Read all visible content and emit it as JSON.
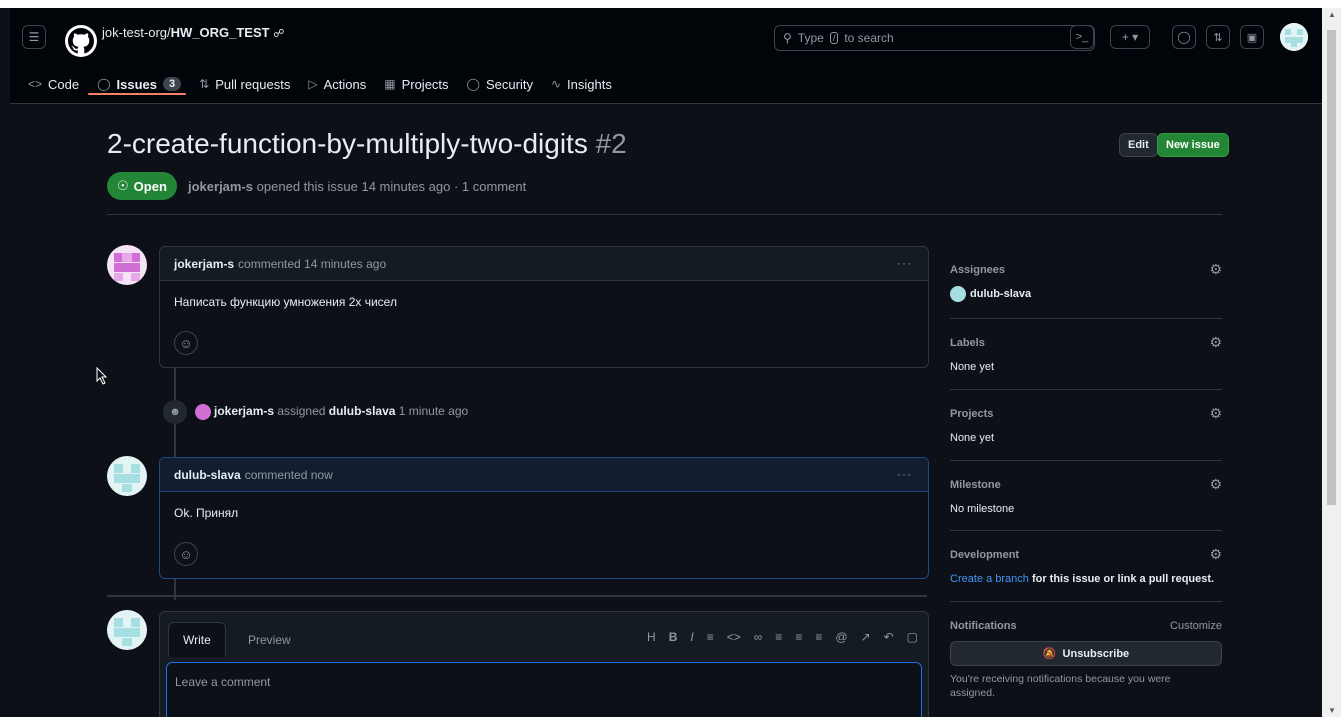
{
  "header": {
    "repo_owner": "jok-test-org/",
    "repo_name": "HW_ORG_TEST",
    "search_placeholder": "Type",
    "search_kbd": "/",
    "search_suffix": "to search"
  },
  "nav": {
    "code": "Code",
    "issues": "Issues",
    "issues_count": "3",
    "pull_requests": "Pull requests",
    "actions": "Actions",
    "projects": "Projects",
    "security": "Security",
    "insights": "Insights"
  },
  "issue": {
    "title": "2-create-function-by-multiply-two-digits",
    "number": "#2",
    "state": "Open",
    "author": "jokerjam-s",
    "meta_text": "opened this issue 14 minutes ago · 1 comment",
    "edit_label": "Edit",
    "new_issue_label": "New issue"
  },
  "comments": [
    {
      "author": "jokerjam-s",
      "time": "commented 14 minutes ago",
      "body": "Написать функцию умножения 2х чисел"
    },
    {
      "author": "dulub-slava",
      "time": "commented now",
      "body": "Ok. Принял"
    }
  ],
  "event": {
    "actor": "jokerjam-s",
    "action": "assigned",
    "target": "dulub-slava",
    "time": "1 minute ago"
  },
  "composer": {
    "write_tab": "Write",
    "preview_tab": "Preview",
    "placeholder": "Leave a comment",
    "toolbar_icons": [
      "heading-icon",
      "bold-icon",
      "italic-icon",
      "quote-icon",
      "code-icon",
      "link-icon",
      "unordered-list-icon",
      "ordered-list-icon",
      "task-list-icon",
      "mention-icon",
      "reference-icon",
      "undo-icon",
      "slash-command-icon"
    ]
  },
  "sidebar": {
    "assignees_title": "Assignees",
    "assignee": "dulub-slava",
    "labels_title": "Labels",
    "labels_value": "None yet",
    "projects_title": "Projects",
    "projects_value": "None yet",
    "milestone_title": "Milestone",
    "milestone_value": "No milestone",
    "development_title": "Development",
    "development_link": "Create a branch",
    "development_rest": "for this issue or link a pull request.",
    "notifications_title": "Notifications",
    "customize_label": "Customize",
    "unsubscribe_label": "Unsubscribe",
    "notifications_note": "You're receiving notifications because you were assigned."
  },
  "colors": {
    "background": "#0d1117",
    "header": "#010409",
    "open_green": "#238636",
    "link_blue": "#4493f8",
    "active_underline": "#f78166"
  }
}
